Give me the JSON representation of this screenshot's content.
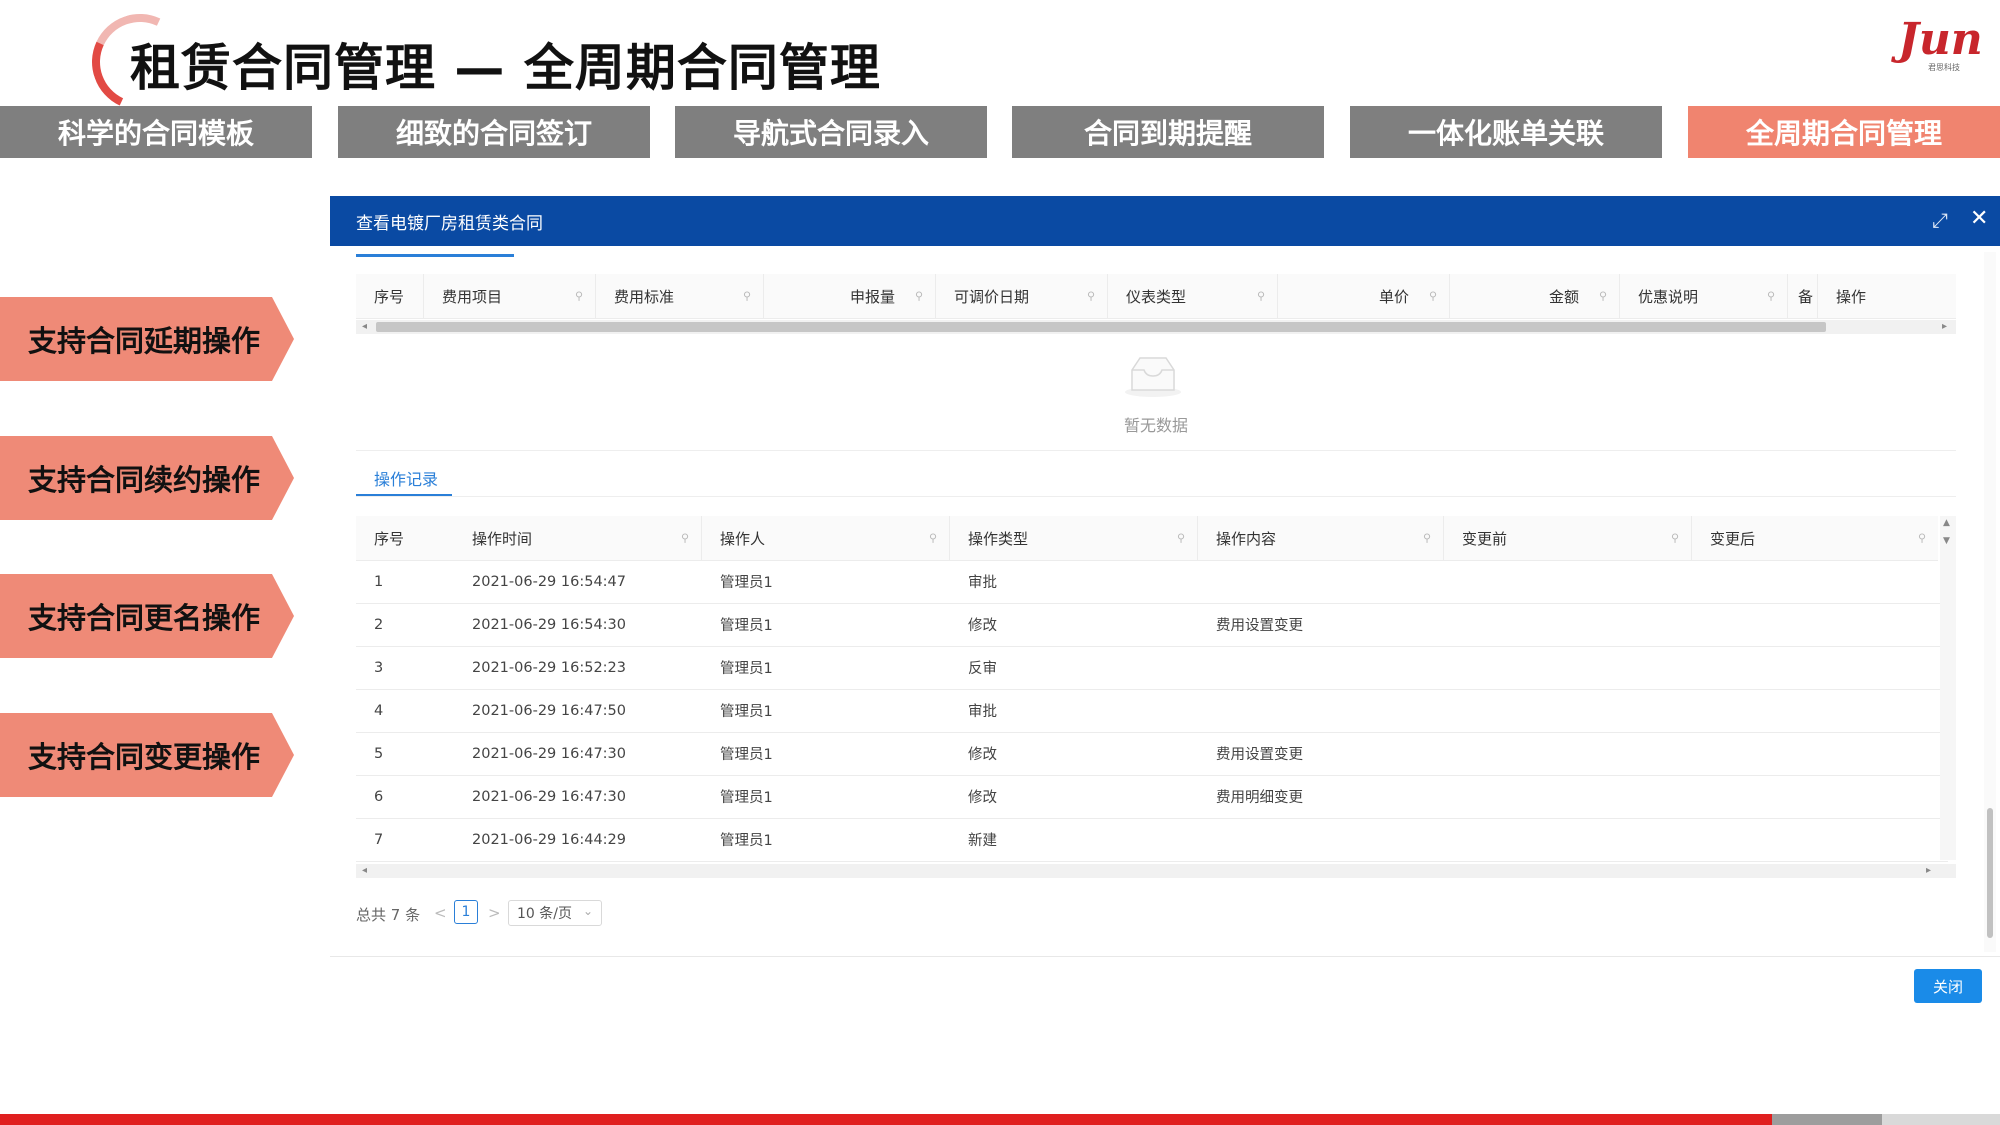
{
  "page": {
    "title": "租赁合同管理 — 全周期合同管理",
    "logo_word": "Jun",
    "logo_sub": "君思科技"
  },
  "top_tabs": [
    {
      "label": "科学的合同模板"
    },
    {
      "label": "细致的合同签订"
    },
    {
      "label": "导航式合同录入"
    },
    {
      "label": "合同到期提醒"
    },
    {
      "label": "一体化账单关联"
    },
    {
      "label": "全周期合同管理"
    }
  ],
  "features": [
    {
      "label": "支持合同延期操作"
    },
    {
      "label": "支持合同续约操作"
    },
    {
      "label": "支持合同更名操作"
    },
    {
      "label": "支持合同变更操作"
    }
  ],
  "dialog": {
    "title": "查看电镀厂房租赁类合同",
    "expand_icon": "⤢",
    "close_icon": "✕",
    "fee_columns": [
      "序号",
      "费用项目",
      "费用标准",
      "申报量",
      "可调价日期",
      "仪表类型",
      "单价",
      "金额",
      "优惠说明",
      "备",
      "操作"
    ],
    "empty_text": "暂无数据",
    "op_tab": "操作记录",
    "log_columns": [
      "序号",
      "操作时间",
      "操作人",
      "操作类型",
      "操作内容",
      "变更前",
      "变更后"
    ],
    "log_rows": [
      [
        "1",
        "2021-06-29 16:54:47",
        "管理员1",
        "审批",
        "",
        "",
        ""
      ],
      [
        "2",
        "2021-06-29 16:54:30",
        "管理员1",
        "修改",
        "费用设置变更",
        "",
        ""
      ],
      [
        "3",
        "2021-06-29 16:52:23",
        "管理员1",
        "反审",
        "",
        "",
        ""
      ],
      [
        "4",
        "2021-06-29 16:47:50",
        "管理员1",
        "审批",
        "",
        "",
        ""
      ],
      [
        "5",
        "2021-06-29 16:47:30",
        "管理员1",
        "修改",
        "费用设置变更",
        "",
        ""
      ],
      [
        "6",
        "2021-06-29 16:47:30",
        "管理员1",
        "修改",
        "费用明细变更",
        "",
        ""
      ],
      [
        "7",
        "2021-06-29 16:44:29",
        "管理员1",
        "新建",
        "",
        "",
        ""
      ]
    ],
    "pager": {
      "total": "总共 7 条",
      "prev": "<",
      "page": "1",
      "next": ">",
      "size": "10 条/页"
    },
    "close_button": "关闭"
  },
  "colors": {
    "header_blue": "#0a4aa3",
    "accent_orange": "#f0846f",
    "tab_grey": "#7f7f7f",
    "link_blue": "#2a7fd8",
    "bottom_red": "#e01f1f"
  }
}
